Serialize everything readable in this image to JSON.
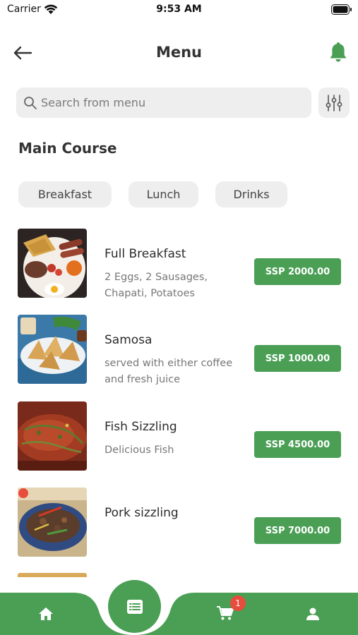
{
  "status_bar": {
    "carrier": "Carrier",
    "time": "9:53 AM"
  },
  "header": {
    "title": "Menu"
  },
  "search": {
    "placeholder": "Search from menu"
  },
  "section": {
    "title": "Main Course"
  },
  "categories": [
    {
      "label": "Breakfast"
    },
    {
      "label": "Lunch"
    },
    {
      "label": "Drinks"
    }
  ],
  "menu_items": [
    {
      "name": "Full Breakfast",
      "description": "2 Eggs, 2 Sausages, Chapati, Potatoes",
      "price": "SSP 2000.00"
    },
    {
      "name": "Samosa",
      "description": "served with either coffee and fresh juice",
      "price": "SSP 1000.00"
    },
    {
      "name": "Fish Sizzling",
      "description": "Delicious Fish",
      "price": "SSP 4500.00"
    },
    {
      "name": "Pork sizzling",
      "description": "",
      "price": "SSP 7000.00"
    }
  ],
  "bottom_nav": {
    "items": [
      {
        "icon": "home-icon"
      },
      {
        "icon": "menu-list-icon"
      },
      {
        "icon": "cart-icon"
      },
      {
        "icon": "profile-icon"
      }
    ],
    "cart_badge": "1"
  },
  "colors": {
    "accent": "#4a9f55",
    "chip_bg": "#eeeeee",
    "badge": "#e74c3c"
  }
}
